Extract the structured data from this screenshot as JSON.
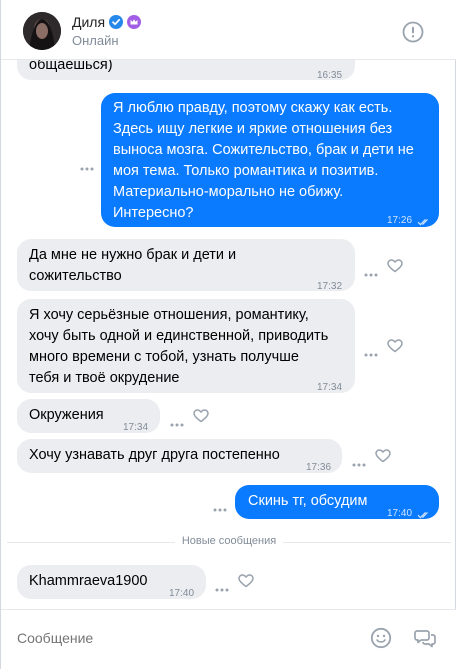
{
  "header": {
    "name": "Диля",
    "status": "Онлайн",
    "icons": [
      "verified-icon",
      "crown-icon",
      "info-icon"
    ]
  },
  "messages": [
    {
      "direction": "in",
      "text": "общаешься)",
      "time": "16:35"
    },
    {
      "direction": "out",
      "lines": [
        "Я люблю правду, поэтому скажу как есть.",
        "Здесь ищу легкие и яркие отношения без",
        "выноса мозга. Сожительство, брак и дети не",
        "моя тема. Только романтика и позитив.",
        "Материально-морально не обижу.",
        "Интересно?"
      ],
      "time": "17:26"
    },
    {
      "direction": "in",
      "lines": [
        "Да мне не нужно брак и дети и",
        "сожительство"
      ],
      "time": "17:32"
    },
    {
      "direction": "in",
      "lines": [
        "Я хочу серьёзные отношения, романтику,",
        "хочу быть одной и единственной, приводить",
        "много времени с тобой, узнать получше",
        "тебя и твоё окрудение"
      ],
      "time": "17:34"
    },
    {
      "direction": "in",
      "text": "Окружения",
      "time": "17:34"
    },
    {
      "direction": "in",
      "text": "Хочу узнавать друг друга постепенно",
      "time": "17:36"
    },
    {
      "direction": "out",
      "text": "Скинь тг, обсудим",
      "time": "17:40"
    },
    {
      "direction": "in",
      "text": "Khammraeva1900",
      "time": "17:40"
    }
  ],
  "divider": {
    "label": "Новые сообщения"
  },
  "composer": {
    "placeholder": "Сообщение"
  },
  "colors": {
    "outgoing": "#0a7aff",
    "incoming": "#ebedf0",
    "muted": "#818c99"
  }
}
